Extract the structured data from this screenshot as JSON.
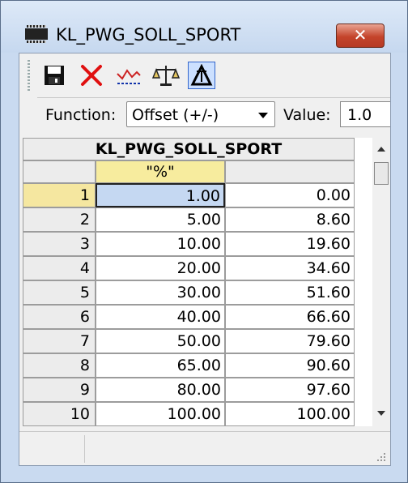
{
  "window": {
    "title": "KL_PWG_SOLL_SPORT",
    "close_label": "✕"
  },
  "toolbar": {
    "buttons": [
      {
        "name": "save-icon"
      },
      {
        "name": "delete-icon"
      },
      {
        "name": "curve-icon"
      },
      {
        "name": "balance-icon"
      },
      {
        "name": "delta-icon",
        "active": true
      }
    ]
  },
  "function_bar": {
    "function_label": "Function:",
    "function_value": "Offset (+/-)",
    "value_label": "Value:",
    "value_value": "1.0"
  },
  "table": {
    "title": "KL_PWG_SOLL_SPORT",
    "unit_header": "\"%\"",
    "selected_row": 1,
    "rows": [
      {
        "index": "1",
        "x": "1.00",
        "y": "0.00"
      },
      {
        "index": "2",
        "x": "5.00",
        "y": "8.60"
      },
      {
        "index": "3",
        "x": "10.00",
        "y": "19.60"
      },
      {
        "index": "4",
        "x": "20.00",
        "y": "34.60"
      },
      {
        "index": "5",
        "x": "30.00",
        "y": "51.60"
      },
      {
        "index": "6",
        "x": "40.00",
        "y": "66.60"
      },
      {
        "index": "7",
        "x": "50.00",
        "y": "79.60"
      },
      {
        "index": "8",
        "x": "65.00",
        "y": "90.60"
      },
      {
        "index": "9",
        "x": "80.00",
        "y": "97.60"
      },
      {
        "index": "10",
        "x": "100.00",
        "y": "100.00"
      }
    ]
  },
  "colors": {
    "selected_row_header": "#f5e7a0",
    "selected_cell": "#c5d8f2",
    "unit_header": "#f7ec9e"
  }
}
